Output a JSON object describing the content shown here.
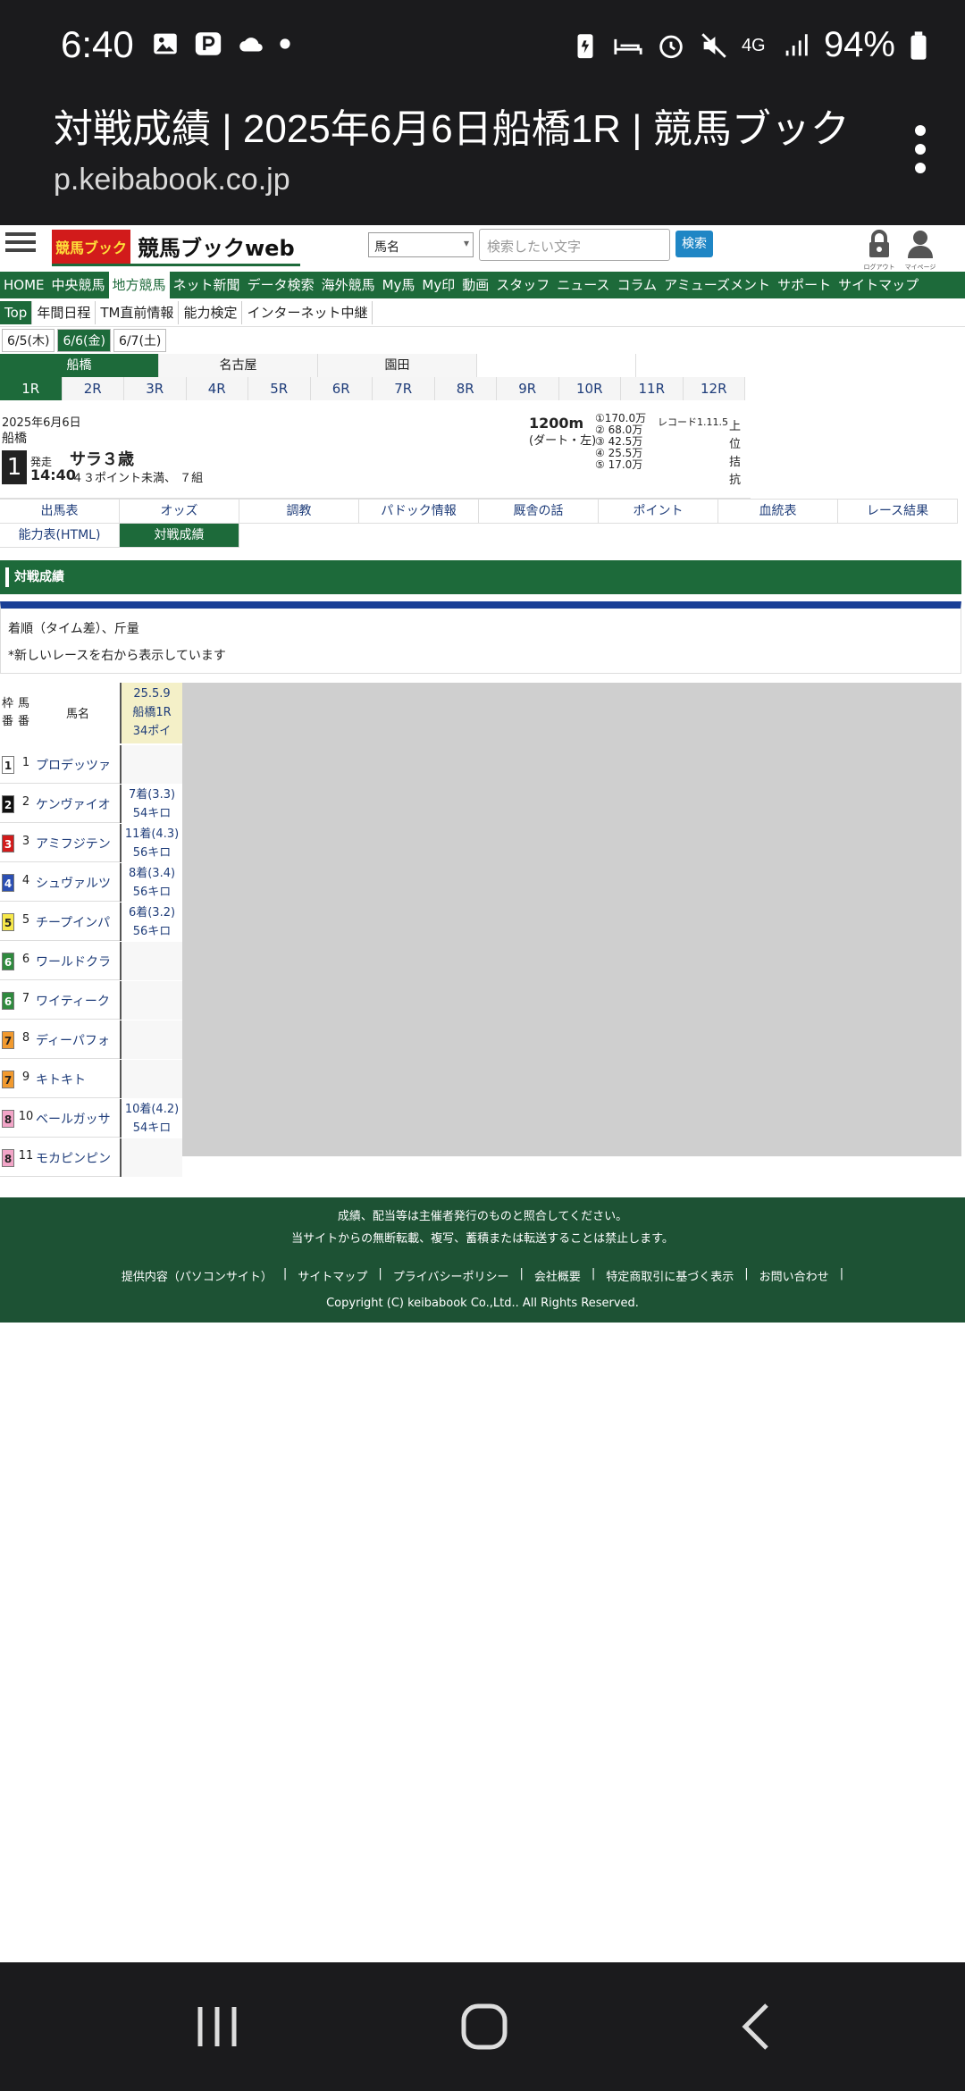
{
  "status_bar": {
    "time": "6:40",
    "battery": "94%",
    "network": "4G",
    "left_icons": [
      "image-icon",
      "paypay-icon",
      "cloud-icon",
      "dot-icon"
    ],
    "right_icons": [
      "battery-saver-icon",
      "sleep-icon",
      "alarm-icon",
      "mute-icon",
      "4g-icon",
      "signal-icon",
      "battery-icon"
    ]
  },
  "browser": {
    "title": "対戦成績 | 2025年6月6日船橋1R | 競馬ブック",
    "url": "p.keibabook.co.jp"
  },
  "header": {
    "menu_label": "",
    "logo_red": "競馬ブック",
    "logo_text": "競馬ブックweb",
    "select_value": "馬名",
    "search_placeholder": "検索したい文字",
    "search_button": "検索",
    "logout_label": "ログアウト",
    "mypage_label": "マイページ"
  },
  "nav_main": [
    "HOME",
    "中央競馬",
    "地方競馬",
    "ネット新聞",
    "データ検索",
    "海外競馬",
    "My馬",
    "My印",
    "動画",
    "スタッフ",
    "ニュース",
    "コラム",
    "アミューズメント",
    "サポート",
    "サイトマップ"
  ],
  "nav_sub": [
    "Top",
    "年間日程",
    "TM直前情報",
    "能力検定",
    "インターネット中継"
  ],
  "date_tabs": [
    "6/5(木)",
    "6/6(金)",
    "6/7(土)"
  ],
  "venues": [
    "船橋",
    "名古屋",
    "園田"
  ],
  "races": [
    "1R",
    "2R",
    "3R",
    "4R",
    "5R",
    "6R",
    "7R",
    "8R",
    "9R",
    "10R",
    "11R",
    "12R"
  ],
  "race_info": {
    "date": "2025年6月6日",
    "venue": "船橋",
    "number": "1",
    "start_label": "発走",
    "start_time": "14:40",
    "class_name": "サラ３歳",
    "conditions": "４３ポイント未満、 ７組",
    "distance": "1200m",
    "surface": "(ダート・左)",
    "prizes": [
      "①170.0万",
      "②  68.0万",
      "③  42.5万",
      "④  25.5万",
      "⑤  17.0万"
    ],
    "record": "レコード1.11.5",
    "upper": "上位拮抗"
  },
  "tabs": [
    "出馬表",
    "オッズ",
    "調教",
    "パドック情報",
    "厩舎の話",
    "ポイント",
    "血統表",
    "レース結果",
    "能力表(HTML)",
    "対戦成績"
  ],
  "section_title": "対戦成績",
  "notes": [
    "着順（タイム差）、斤量",
    "*新しいレースを右から表示しています"
  ],
  "table": {
    "header": {
      "waku": "枠番",
      "uma": "馬番",
      "name": "馬名"
    },
    "race_header": [
      "25.5.9",
      "船橋1R",
      "34ポイ"
    ],
    "rows": [
      {
        "waku": "1",
        "num": "1",
        "name": "プロデッツァ",
        "r1": "",
        "r2": "",
        "wcolor": "#ffffff",
        "wtext": "#222222"
      },
      {
        "waku": "2",
        "num": "2",
        "name": "ケンヴァイオ",
        "r1": "7着(3.3)",
        "r2": "54キロ",
        "wcolor": "#111111",
        "wtext": "#ffffff"
      },
      {
        "waku": "3",
        "num": "3",
        "name": "アミフジテン",
        "r1": "11着(4.3)",
        "r2": "56キロ",
        "wcolor": "#d21b1b",
        "wtext": "#ffffff"
      },
      {
        "waku": "4",
        "num": "4",
        "name": "シュヴァルツ",
        "r1": "8着(3.4)",
        "r2": "56キロ",
        "wcolor": "#2b4fb3",
        "wtext": "#ffffff"
      },
      {
        "waku": "5",
        "num": "5",
        "name": "チープインパ",
        "r1": "6着(3.2)",
        "r2": "56キロ",
        "wcolor": "#f7e84a",
        "wtext": "#222222"
      },
      {
        "waku": "6",
        "num": "6",
        "name": "ワールドクラ",
        "r1": "",
        "r2": "",
        "wcolor": "#2f8a3e",
        "wtext": "#ffffff"
      },
      {
        "waku": "6",
        "num": "7",
        "name": "ワイティーク",
        "r1": "",
        "r2": "",
        "wcolor": "#2f8a3e",
        "wtext": "#ffffff"
      },
      {
        "waku": "7",
        "num": "8",
        "name": "ディーパフォ",
        "r1": "",
        "r2": "",
        "wcolor": "#f29a2e",
        "wtext": "#222222"
      },
      {
        "waku": "7",
        "num": "9",
        "name": "キトキト",
        "r1": "",
        "r2": "",
        "wcolor": "#f29a2e",
        "wtext": "#222222"
      },
      {
        "waku": "8",
        "num": "10",
        "name": "ベールガッサ",
        "r1": "10着(4.2)",
        "r2": "54キロ",
        "wcolor": "#f3a5c8",
        "wtext": "#222222"
      },
      {
        "waku": "8",
        "num": "11",
        "name": "モカピンピン",
        "r1": "",
        "r2": "",
        "wcolor": "#f3a5c8",
        "wtext": "#222222"
      }
    ]
  },
  "footer": {
    "note1": "成績、配当等は主催者発行のものと照合してください。",
    "note2": "当サイトからの無断転載、複写、蓄積または転送することは禁止します。",
    "links": [
      "提供内容（パソコンサイト）",
      "サイトマップ",
      "プライバシーポリシー",
      "会社概要",
      "特定商取引に基づく表示",
      "お問い合わせ"
    ],
    "copyright": "Copyright (C) keibabook Co.,Ltd.. All Rights Reserved."
  },
  "colors": {
    "green": "#1d6a3a",
    "link": "#1f3d7a",
    "accent_red": "#d21b1b",
    "blue_bar": "#1a3f96"
  }
}
